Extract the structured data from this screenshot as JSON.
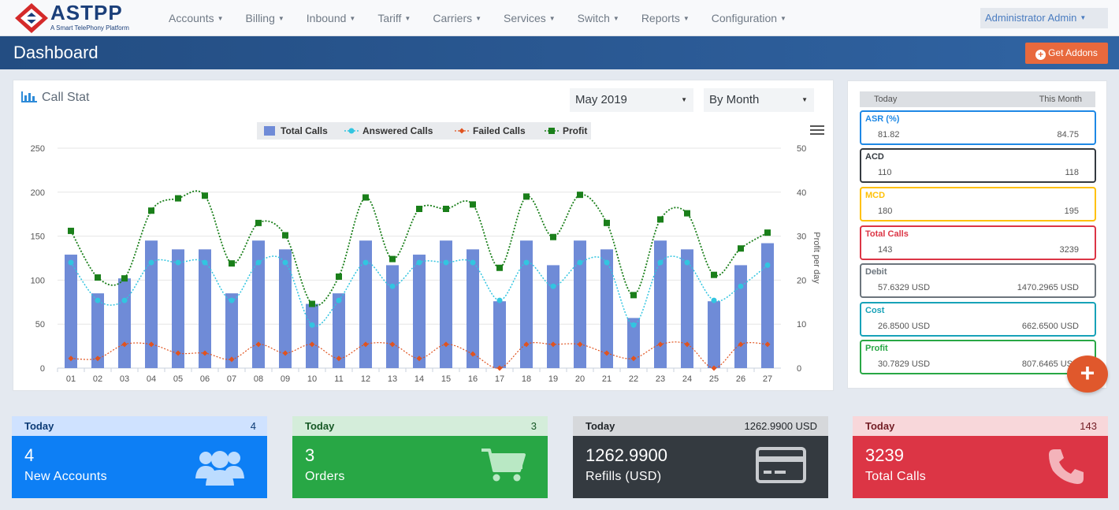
{
  "brand": {
    "name": "ASTPP",
    "tagline": "A Smart TelePhony Platform"
  },
  "nav": {
    "items": [
      "Accounts",
      "Billing",
      "Inbound",
      "Tariff",
      "Carriers",
      "Services",
      "Switch",
      "Reports",
      "Configuration"
    ],
    "user": "Administrator Admin"
  },
  "header": {
    "title": "Dashboard",
    "addons_label": "Get Addons"
  },
  "call_stat": {
    "title": "Call Stat",
    "month_select": "May 2019",
    "period_select": "By Month"
  },
  "chart_data": {
    "type": "bar",
    "categories": [
      "01",
      "02",
      "03",
      "04",
      "05",
      "06",
      "07",
      "08",
      "09",
      "10",
      "11",
      "12",
      "13",
      "14",
      "15",
      "16",
      "17",
      "18",
      "19",
      "20",
      "21",
      "22",
      "23",
      "24",
      "25",
      "26",
      "27"
    ],
    "series": [
      {
        "name": "Total Calls",
        "type": "bar",
        "axis": "left",
        "color": "#6f8bd7",
        "values": [
          129,
          85,
          102,
          145,
          135,
          135,
          85,
          145,
          135,
          73,
          85,
          145,
          117,
          129,
          145,
          135,
          76,
          145,
          117,
          145,
          135,
          57,
          145,
          135,
          76,
          117,
          142
        ]
      },
      {
        "name": "Answered Calls",
        "type": "line",
        "axis": "left",
        "color": "#32c5e0",
        "values": [
          120,
          77,
          77,
          120,
          120,
          120,
          77,
          120,
          120,
          49,
          77,
          120,
          93,
          120,
          120,
          120,
          77,
          120,
          93,
          120,
          120,
          49,
          120,
          120,
          77,
          93,
          117
        ]
      },
      {
        "name": "Failed Calls",
        "type": "line",
        "axis": "left",
        "color": "#e0531f",
        "values": [
          11,
          11,
          27,
          27,
          17,
          17,
          10,
          27,
          17,
          27,
          11,
          27,
          27,
          11,
          27,
          16,
          0,
          27,
          27,
          27,
          17,
          11,
          27,
          27,
          0,
          27,
          27
        ]
      },
      {
        "name": "Profit",
        "type": "line",
        "axis": "right",
        "color": "#1a7f1a",
        "values": [
          31.2,
          20.6,
          20.4,
          35.8,
          38.6,
          39.2,
          23.8,
          33.0,
          30.2,
          14.6,
          20.8,
          38.8,
          24.8,
          36.2,
          36.2,
          37.2,
          22.8,
          39.0,
          29.8,
          39.4,
          33.0,
          16.6,
          33.8,
          35.2,
          21.2,
          27.2,
          30.8
        ]
      }
    ],
    "ylim": [
      0,
      250
    ],
    "yticks": [
      0,
      50,
      100,
      150,
      200,
      250
    ],
    "y2lim": [
      0,
      50
    ],
    "y2ticks": [
      0,
      10,
      20,
      30,
      40,
      50
    ],
    "y2label": "Profit per day",
    "legend": "top-center",
    "grid": true
  },
  "stats": {
    "head_left": "Today",
    "head_right": "This Month",
    "rows": [
      {
        "name": "ASR (%)",
        "today": "81.82",
        "month": "84.75",
        "color": "#1e88e5"
      },
      {
        "name": "ACD",
        "today": "110",
        "month": "118",
        "color": "#343a40"
      },
      {
        "name": "MCD",
        "today": "180",
        "month": "195",
        "color": "#ffc107"
      },
      {
        "name": "Total Calls",
        "today": "143",
        "month": "3239",
        "color": "#dc3545"
      },
      {
        "name": "Debit",
        "today": "57.6329 USD",
        "month": "1470.2965 USD",
        "color": "#6c757d"
      },
      {
        "name": "Cost",
        "today": "26.8500 USD",
        "month": "662.6500 USD",
        "color": "#17a2b8"
      },
      {
        "name": "Profit",
        "today": "30.7829 USD",
        "month": "807.6465 USD",
        "color": "#28a745"
      }
    ]
  },
  "tiles": [
    {
      "head": "Today",
      "count": "4",
      "big": "4",
      "sub": "New Accounts",
      "icon": "users-icon",
      "head_bg": "#cfe2ff",
      "body_bg": "#0d7ff5"
    },
    {
      "head": "Today",
      "count": "3",
      "big": "3",
      "sub": "Orders",
      "icon": "cart-icon",
      "head_bg": "#d4edda",
      "body_bg": "#28a745"
    },
    {
      "head": "Today",
      "count": "1262.9900 USD",
      "big": "1262.9900",
      "sub": "Refills (USD)",
      "icon": "credit-card-icon",
      "head_bg": "#d6d8db",
      "body_bg": "#343a40"
    },
    {
      "head": "Today",
      "count": "143",
      "big": "3239",
      "sub": "Total Calls",
      "icon": "phone-icon",
      "head_bg": "#f8d7da",
      "body_bg": "#dc3545"
    }
  ]
}
